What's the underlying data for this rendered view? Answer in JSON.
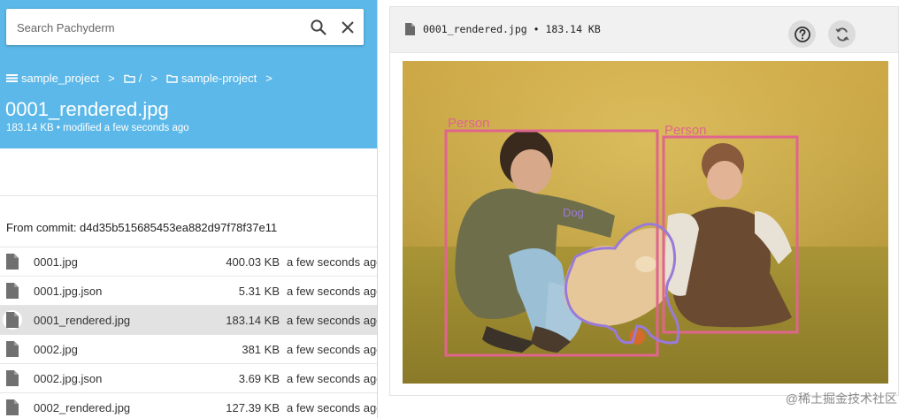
{
  "search": {
    "placeholder": "Search Pachyderm"
  },
  "breadcrumb": {
    "repo": "sample_project",
    "root": "/",
    "folder": "sample-project",
    "separator": ">"
  },
  "file": {
    "name": "0001_rendered.jpg",
    "meta": "183.14 KB • modified a few seconds ago"
  },
  "commit": {
    "text": "From commit: d4d35b515685453ea882d97f78f37e11"
  },
  "files": [
    {
      "name": "0001.jpg",
      "size": "400.03 KB",
      "modified": "a few seconds ago"
    },
    {
      "name": "0001.jpg.json",
      "size": "5.31 KB",
      "modified": "a few seconds ago"
    },
    {
      "name": "0001_rendered.jpg",
      "size": "183.14 KB",
      "modified": "a few seconds ago"
    },
    {
      "name": "0002.jpg",
      "size": "381 KB",
      "modified": "a few seconds ago"
    },
    {
      "name": "0002.jpg.json",
      "size": "3.69 KB",
      "modified": "a few seconds ago"
    },
    {
      "name": "0002_rendered.jpg",
      "size": "127.39 KB",
      "modified": "a few seconds ago"
    }
  ],
  "preview": {
    "title": "0001_rendered.jpg • 183.14 KB",
    "labels": {
      "person1": "Person",
      "person2": "Person",
      "dog": "Dog"
    }
  },
  "watermark": "@稀土掘金技术社区",
  "icons": {
    "search": "search-icon",
    "close": "close-icon",
    "repo": "list-icon",
    "folder": "folder-icon",
    "file": "file-icon",
    "help": "help-icon",
    "refresh": "refresh-icon"
  },
  "colors": {
    "header": "#5cb8e8",
    "person_box": "#e0658e",
    "dog_outline": "#9a7ad8",
    "selected_row": "#e2e2e2"
  }
}
